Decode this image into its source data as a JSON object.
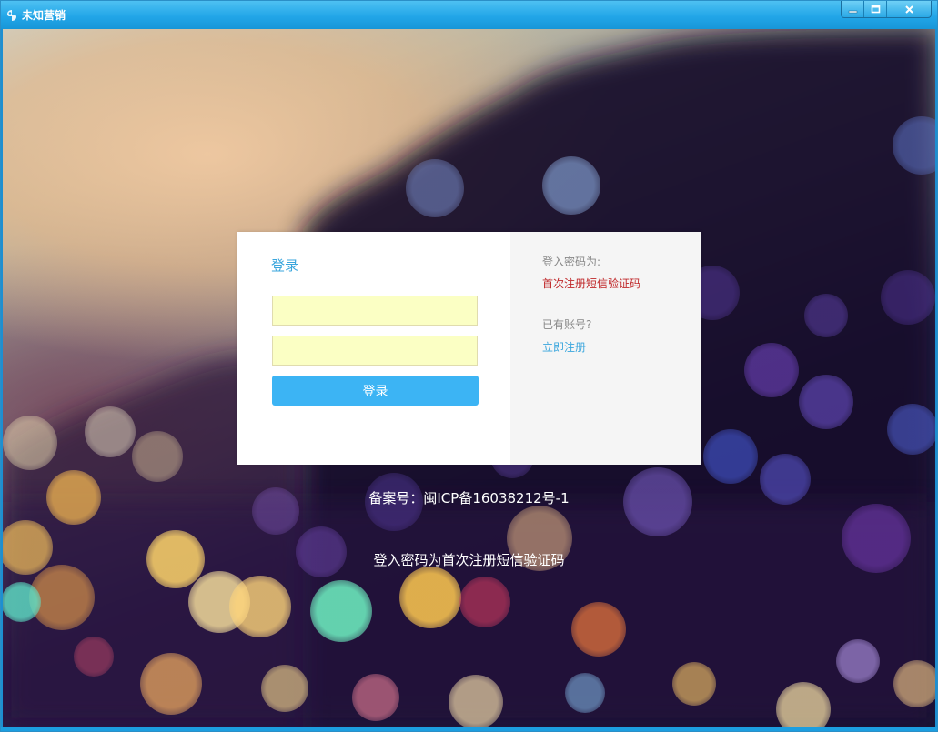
{
  "window": {
    "title": "未知营销",
    "app_icon": "app-logo-icon",
    "controls": [
      "minimize-icon",
      "maximize-icon",
      "close-icon"
    ],
    "accent_color": "#22a6e8"
  },
  "login": {
    "title": "登录",
    "username_value": "",
    "password_value": "",
    "submit_label": "登录",
    "button_color": "#3cb4f4",
    "field_color": "#fbffc4"
  },
  "sidebar": {
    "hint_label": "登入密码为:",
    "hint_value": "首次注册短信验证码",
    "hint_color": "#c0282a",
    "account_label": "已有账号?",
    "register_link": "立即注册",
    "link_color": "#3aa6dd"
  },
  "footer": {
    "icp": "备案号：闽ICP备16038212号-1",
    "note": "登入密码为首次注册短信验证码"
  }
}
